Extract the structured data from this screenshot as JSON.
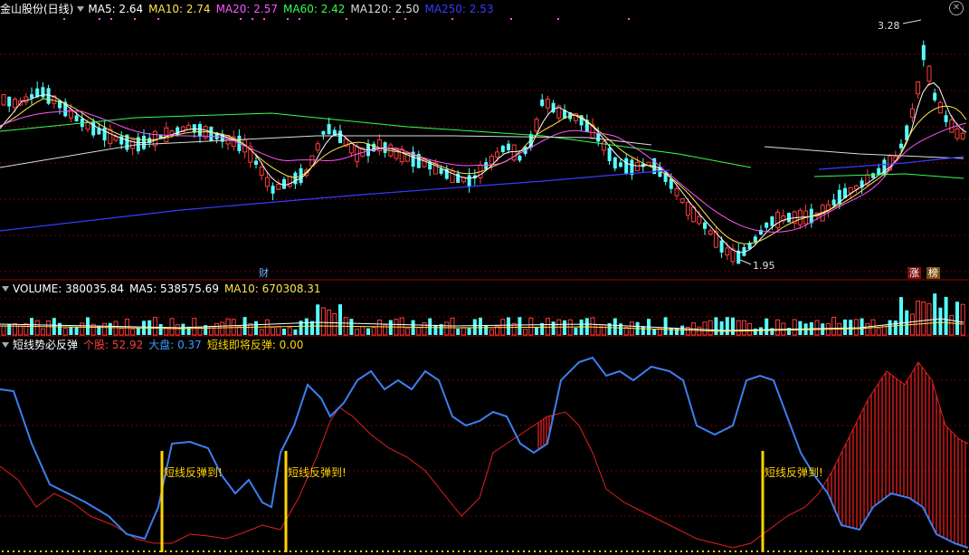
{
  "main_header": {
    "title": "金山股份(日线)",
    "ma": [
      {
        "label": "MA5: 2.64",
        "color": "#ffffff"
      },
      {
        "label": "MA10: 2.74",
        "color": "#ffe34a"
      },
      {
        "label": "MA20: 2.57",
        "color": "#ff55ff"
      },
      {
        "label": "MA60: 2.42",
        "color": "#33ff55"
      },
      {
        "label": "MA120: 2.50",
        "color": "#dddddd"
      },
      {
        "label": "MA250: 2.53",
        "color": "#3a3aff"
      }
    ]
  },
  "volume_header": {
    "title": "VOLUME: 380035.84",
    "ma5": "MA5: 538575.69",
    "ma10": "MA10: 670308.31"
  },
  "indicator_header": {
    "title": "短线势必反弹",
    "stock": "个股: 52.92",
    "market": "大盘: 0.37",
    "signal": "短线即将反弹: 0.00"
  },
  "annotations": {
    "high_price": "3.28",
    "low_price": "1.95",
    "badge_cai": "财",
    "badge_zhang": "涨",
    "badge_bang": "榜"
  },
  "signals": [
    {
      "label": "短线反弹到!"
    },
    {
      "label": "短线反弹到!"
    },
    {
      "label": "短线反弹到!"
    }
  ],
  "colors": {
    "up": "#ff3c3c",
    "down": "#54ffff",
    "ma5": "#ffffff",
    "ma10": "#ffe34a",
    "ma20": "#ff55ff",
    "ma60": "#33ff55",
    "ma120": "#dddddd",
    "ma250": "#3a3aff",
    "indicator_stock": "#3c7ff0",
    "indicator_market": "#e02020",
    "signal": "#ffd400",
    "grid": "#7a0000"
  }
}
